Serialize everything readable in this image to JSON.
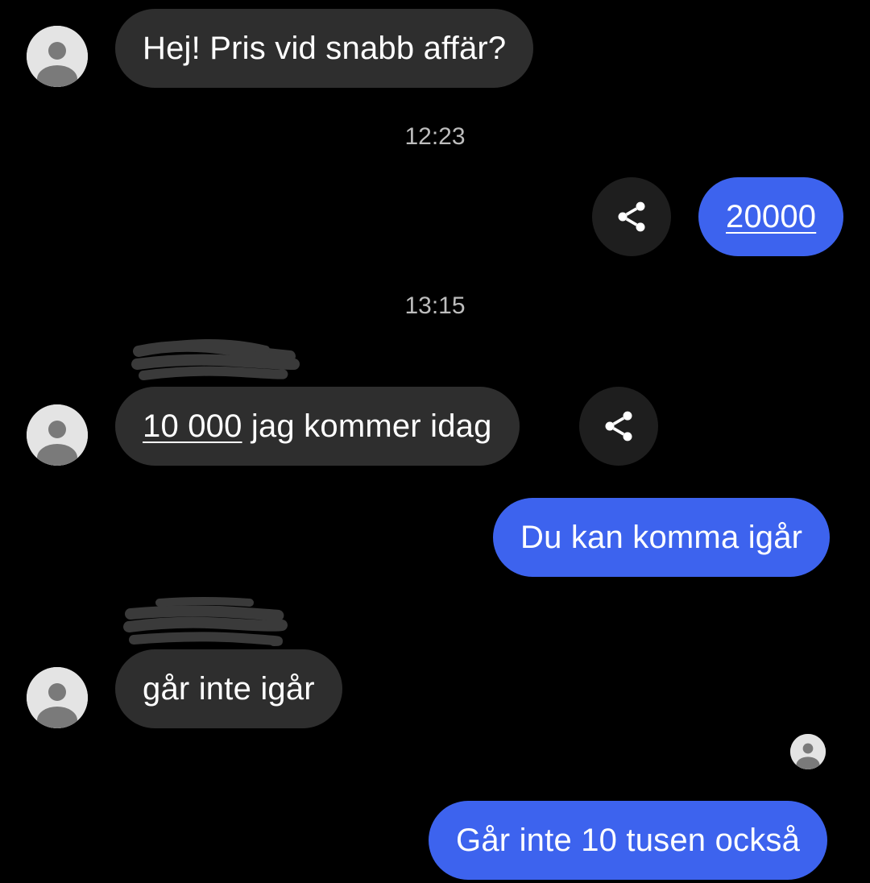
{
  "messages": [
    {
      "text": "Hej! Pris vid snabb affär?"
    },
    {
      "timestamp": "12:23"
    },
    {
      "link_text": "20000"
    },
    {
      "timestamp": "13:15"
    },
    {
      "link_text": "10 000",
      "text": "jag kommer idag"
    },
    {
      "text": "Du kan komma igår"
    },
    {
      "text": "går inte igår"
    },
    {
      "text": "Går inte 10 tusen också"
    }
  ],
  "icons": {
    "avatar": "person-icon",
    "share": "share-icon"
  },
  "colors": {
    "background": "#000000",
    "incoming_bubble": "#2e2e2e",
    "outgoing_bubble": "#3d63ee",
    "timestamp_text": "#bdbdbd",
    "share_button": "#1e1e1e"
  }
}
